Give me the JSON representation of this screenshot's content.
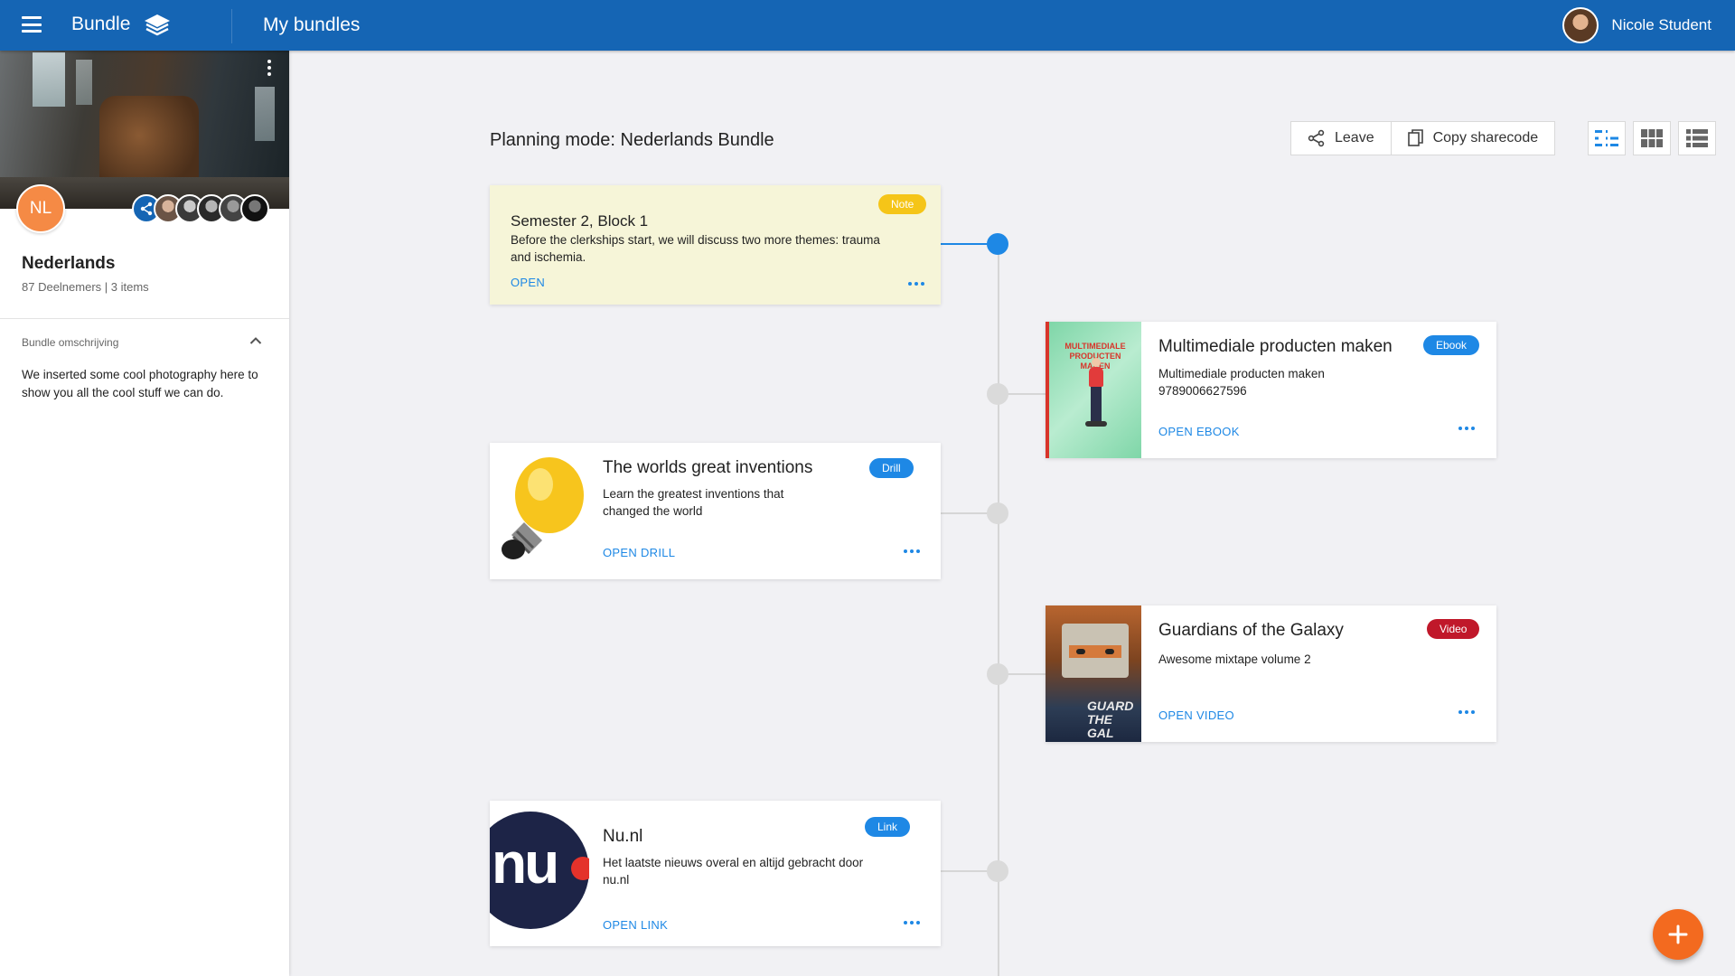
{
  "app": {
    "name": "Bundle"
  },
  "header": {
    "title": "My bundles",
    "user_name": "Nicole Student"
  },
  "sidebar": {
    "group_initials": "NL",
    "group_name": "Nederlands",
    "group_meta": "87 Deelnemers | 3 items",
    "description_label": "Bundle omschrijving",
    "description": "We inserted some cool photography here to show you all the cool stuff we can do."
  },
  "main": {
    "heading": "Planning mode: Nederlands Bundle",
    "toolbar": {
      "leave_label": "Leave",
      "copy_label": "Copy sharecode"
    }
  },
  "items": {
    "note": {
      "badge": "Note",
      "title": "Semester 2, Block 1",
      "description": "Before the clerkships start, we will discuss two more themes: trauma and ischemia.",
      "action": "OPEN"
    },
    "ebook": {
      "badge": "Ebook",
      "title": "Multimediale producten maken",
      "description": "Multimediale producten maken",
      "isbn": "9789006627596",
      "action": "OPEN EBOOK",
      "cover_text": "MULTIMEDIALE PRODUCTEN MAKEN"
    },
    "drill": {
      "badge": "Drill",
      "title": "The worlds great inventions",
      "description": "Learn the greatest inventions that changed the world",
      "action": "OPEN DRILL"
    },
    "video": {
      "badge": "Video",
      "title": "Guardians of the Galaxy",
      "description": "Awesome mixtape volume 2",
      "action": "OPEN VIDEO",
      "cover_text": "GUARD THE GAL"
    },
    "link": {
      "badge": "Link",
      "title": "Nu.nl",
      "description": "Het laatste nieuws overal en altijd gebracht door nu.nl",
      "action": "OPEN LINK",
      "logo_text": "nu"
    }
  },
  "colors": {
    "topbar": "#1565b4",
    "accent": "#1e88e5",
    "note_badge": "#f5c518",
    "video_badge": "#c0182a",
    "fab": "#f36a1f",
    "avatar": "#f58a45"
  }
}
